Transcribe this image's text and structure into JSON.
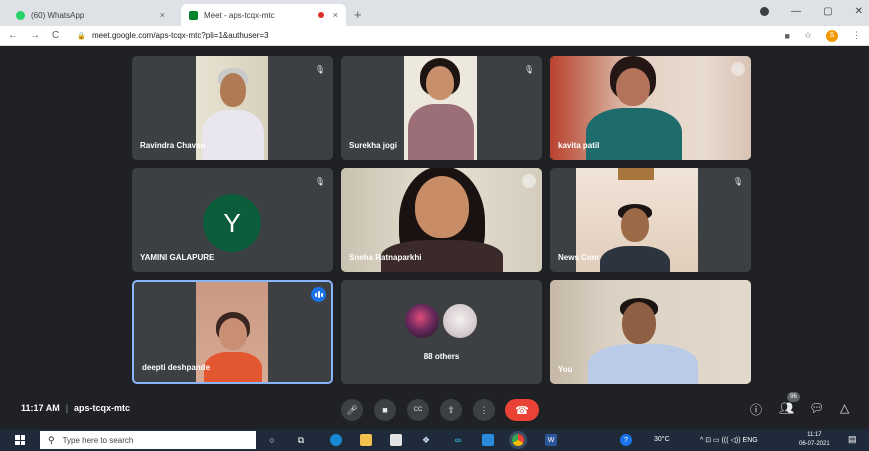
{
  "browser": {
    "tabs": [
      {
        "label": "(60) WhatsApp",
        "close": "×",
        "icon": "whatsapp-icon",
        "color": "#25d366"
      },
      {
        "label": "Meet - aps-tcqx-mtc",
        "close": "×",
        "icon": "meet-icon",
        "color": "#00832d"
      }
    ],
    "new_tab": "+",
    "window_controls": {
      "minimize": "—",
      "maximize": "▢",
      "close": "✕"
    },
    "nav": {
      "back": "←",
      "forward": "→",
      "reload": "C"
    },
    "url": "meet.google.com/aps-tcqx-mtc?pli=1&authuser=3",
    "lock": "🔒",
    "profile_initial": "S",
    "star": "☆",
    "menu": "⋮",
    "camera_indicator": "■"
  },
  "meet": {
    "participants": [
      {
        "name": "Ravindra Chavan",
        "muted": true
      },
      {
        "name": "Surekha jogi",
        "muted": true
      },
      {
        "name": "kavita patil",
        "muted": true
      },
      {
        "name": "YAMINI GALAPURE",
        "muted": true,
        "initial": "Y",
        "avatar_color": "#0b5d3b"
      },
      {
        "name": "Sneha Ratnaparkhi",
        "muted": true
      },
      {
        "name": "News Com",
        "muted": true
      },
      {
        "name": "deepti deshpande",
        "speaking": true
      },
      {
        "name": "88 others"
      },
      {
        "name": "You"
      }
    ],
    "mute_glyph": "🎙︎",
    "time": "11:17 AM",
    "separator": "|",
    "meeting_code": "aps-tcqx-mtc",
    "controls": {
      "mic": "🎤︎",
      "camera": "■",
      "captions": "CC",
      "present": "⇧",
      "more": "⋮",
      "hangup": "☎"
    },
    "right_controls": {
      "info": "ⓘ",
      "people": "👥︎",
      "chat": "💬︎",
      "activities": "△"
    },
    "participant_count": "96",
    "accent": "#1a73e8",
    "hangup_color": "#ea4335"
  },
  "taskbar": {
    "search_placeholder": "Type here to search",
    "search_glyph": "⚲",
    "cortana": "○",
    "task_view": "⧉",
    "weather": "30°C",
    "tray_icons": "^ ⊡ ▭ ((( ◁)) ENG",
    "time": "11:17",
    "date": "06-07-2021",
    "notification": "▤"
  }
}
